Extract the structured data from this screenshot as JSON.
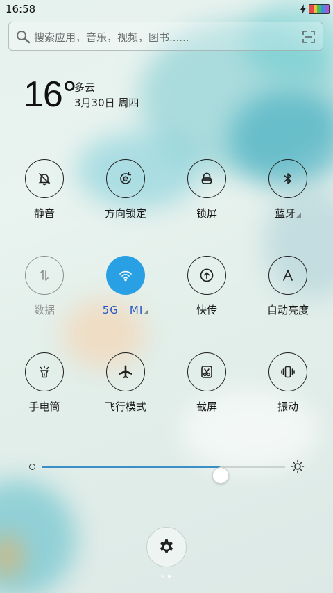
{
  "status_bar": {
    "time": "16:58",
    "battery_colors": [
      "#e24848",
      "#f2c038",
      "#45c05a",
      "#3e8ee6",
      "#a65ad6"
    ]
  },
  "search": {
    "placeholder": "搜索应用，音乐，视频，图书......",
    "icon": "search-icon",
    "action_icon": "scan-icon"
  },
  "weather": {
    "temperature": "16°",
    "condition": "多云",
    "date": "3月30日 周四"
  },
  "toggles": [
    {
      "label": "静音",
      "icon": "bell-mute-icon",
      "state": "off"
    },
    {
      "label": "方向锁定",
      "icon": "rotation-lock-icon",
      "state": "off"
    },
    {
      "label": "锁屏",
      "icon": "lock-icon",
      "state": "off"
    },
    {
      "label": "蓝牙",
      "icon": "bluetooth-icon",
      "state": "off",
      "has_menu": true
    },
    {
      "label": "数据",
      "icon": "mobile-data-icon",
      "state": "disabled"
    },
    {
      "label": "5G　MI",
      "icon": "wifi-icon",
      "state": "on",
      "has_menu": true
    },
    {
      "label": "快传",
      "icon": "transfer-icon",
      "state": "off"
    },
    {
      "label": "自动亮度",
      "icon": "auto-brightness-icon",
      "state": "off"
    },
    {
      "label": "手电筒",
      "icon": "flashlight-icon",
      "state": "off"
    },
    {
      "label": "飞行模式",
      "icon": "airplane-icon",
      "state": "off"
    },
    {
      "label": "截屏",
      "icon": "screenshot-icon",
      "state": "off"
    },
    {
      "label": "振动",
      "icon": "vibrate-icon",
      "state": "off"
    }
  ],
  "brightness": {
    "level": 0.73,
    "min_icon": "brightness-low-icon",
    "max_icon": "brightness-high-icon"
  },
  "settings": {
    "icon": "gear-icon"
  },
  "pager": {
    "pages": 2,
    "current": 2
  },
  "colors": {
    "accent": "#2aa0e4",
    "wifi_label": "#2156c7",
    "text": "#1a1a1a"
  }
}
